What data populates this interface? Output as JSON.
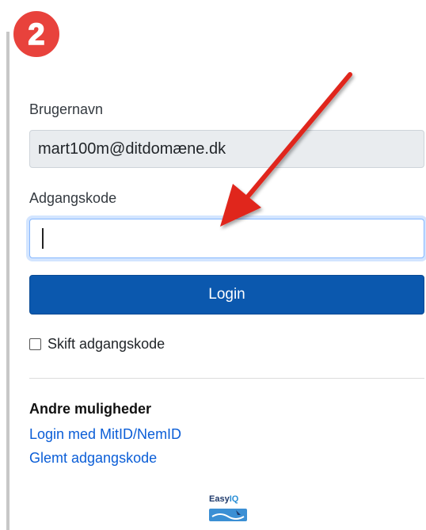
{
  "step_badge": {
    "number": "2",
    "color": "#e8423c"
  },
  "form": {
    "username_label": "Brugernavn",
    "username_value": "mart100m@ditdomæne.dk",
    "password_label": "Adgangskode",
    "password_value": "",
    "login_label": "Login",
    "change_password_label": "Skift adgangskode"
  },
  "other_options": {
    "title": "Andre muligheder",
    "links": [
      "Login med MitID/NemID",
      "Glemt adgangskode"
    ]
  },
  "logo": {
    "part1": "Easy",
    "part2": "IQ"
  },
  "colors": {
    "primary": "#0b58ae",
    "arrow": "#e0261e",
    "link": "#0b5ed7"
  },
  "icons": {
    "arrow": "red-arrow-icon",
    "badge": "step-badge-icon"
  }
}
